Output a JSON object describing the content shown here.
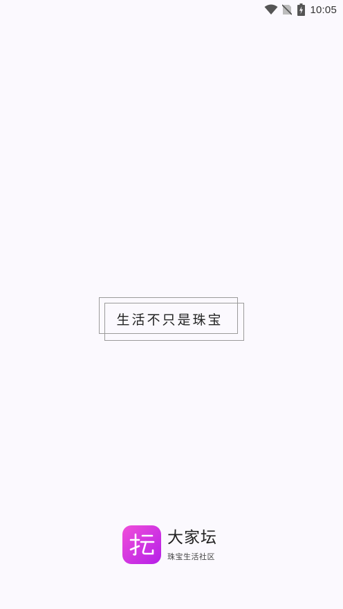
{
  "status_bar": {
    "time": "10:05",
    "icons": [
      "wifi-icon",
      "no-sim-icon",
      "battery-charging-icon"
    ]
  },
  "splash": {
    "slogan": "生活不只是珠宝"
  },
  "brand": {
    "name": "大家坛",
    "tagline": "珠宝生活社区",
    "logo_icon": "app-logo-icon",
    "gradient_start": "#f04fd9",
    "gradient_end": "#b51fe8"
  },
  "colors": {
    "background": "#fbf9fe",
    "text": "#222222",
    "frame": "#9a9a9a"
  }
}
